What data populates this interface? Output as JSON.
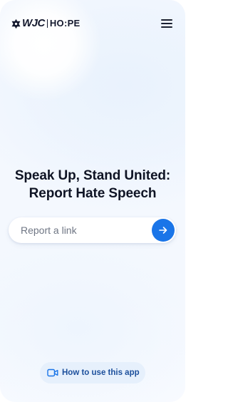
{
  "header": {
    "logo_wjc": "WJC",
    "logo_hope": "HO:PE",
    "menu_icon": "hamburger-menu-icon"
  },
  "main": {
    "headline_line1": "Speak Up, Stand United:",
    "headline_line2": "Report Hate Speech"
  },
  "report": {
    "placeholder": "Report a link",
    "value": "",
    "submit_icon": "arrow-right-icon"
  },
  "footer": {
    "howto_label": "How to use this app",
    "howto_icon": "video-camera-icon"
  },
  "colors": {
    "accent": "#1a75e8",
    "text_dark": "#0f1424",
    "howto_bg": "#e6f0fc",
    "howto_text": "#1c4f9c"
  }
}
